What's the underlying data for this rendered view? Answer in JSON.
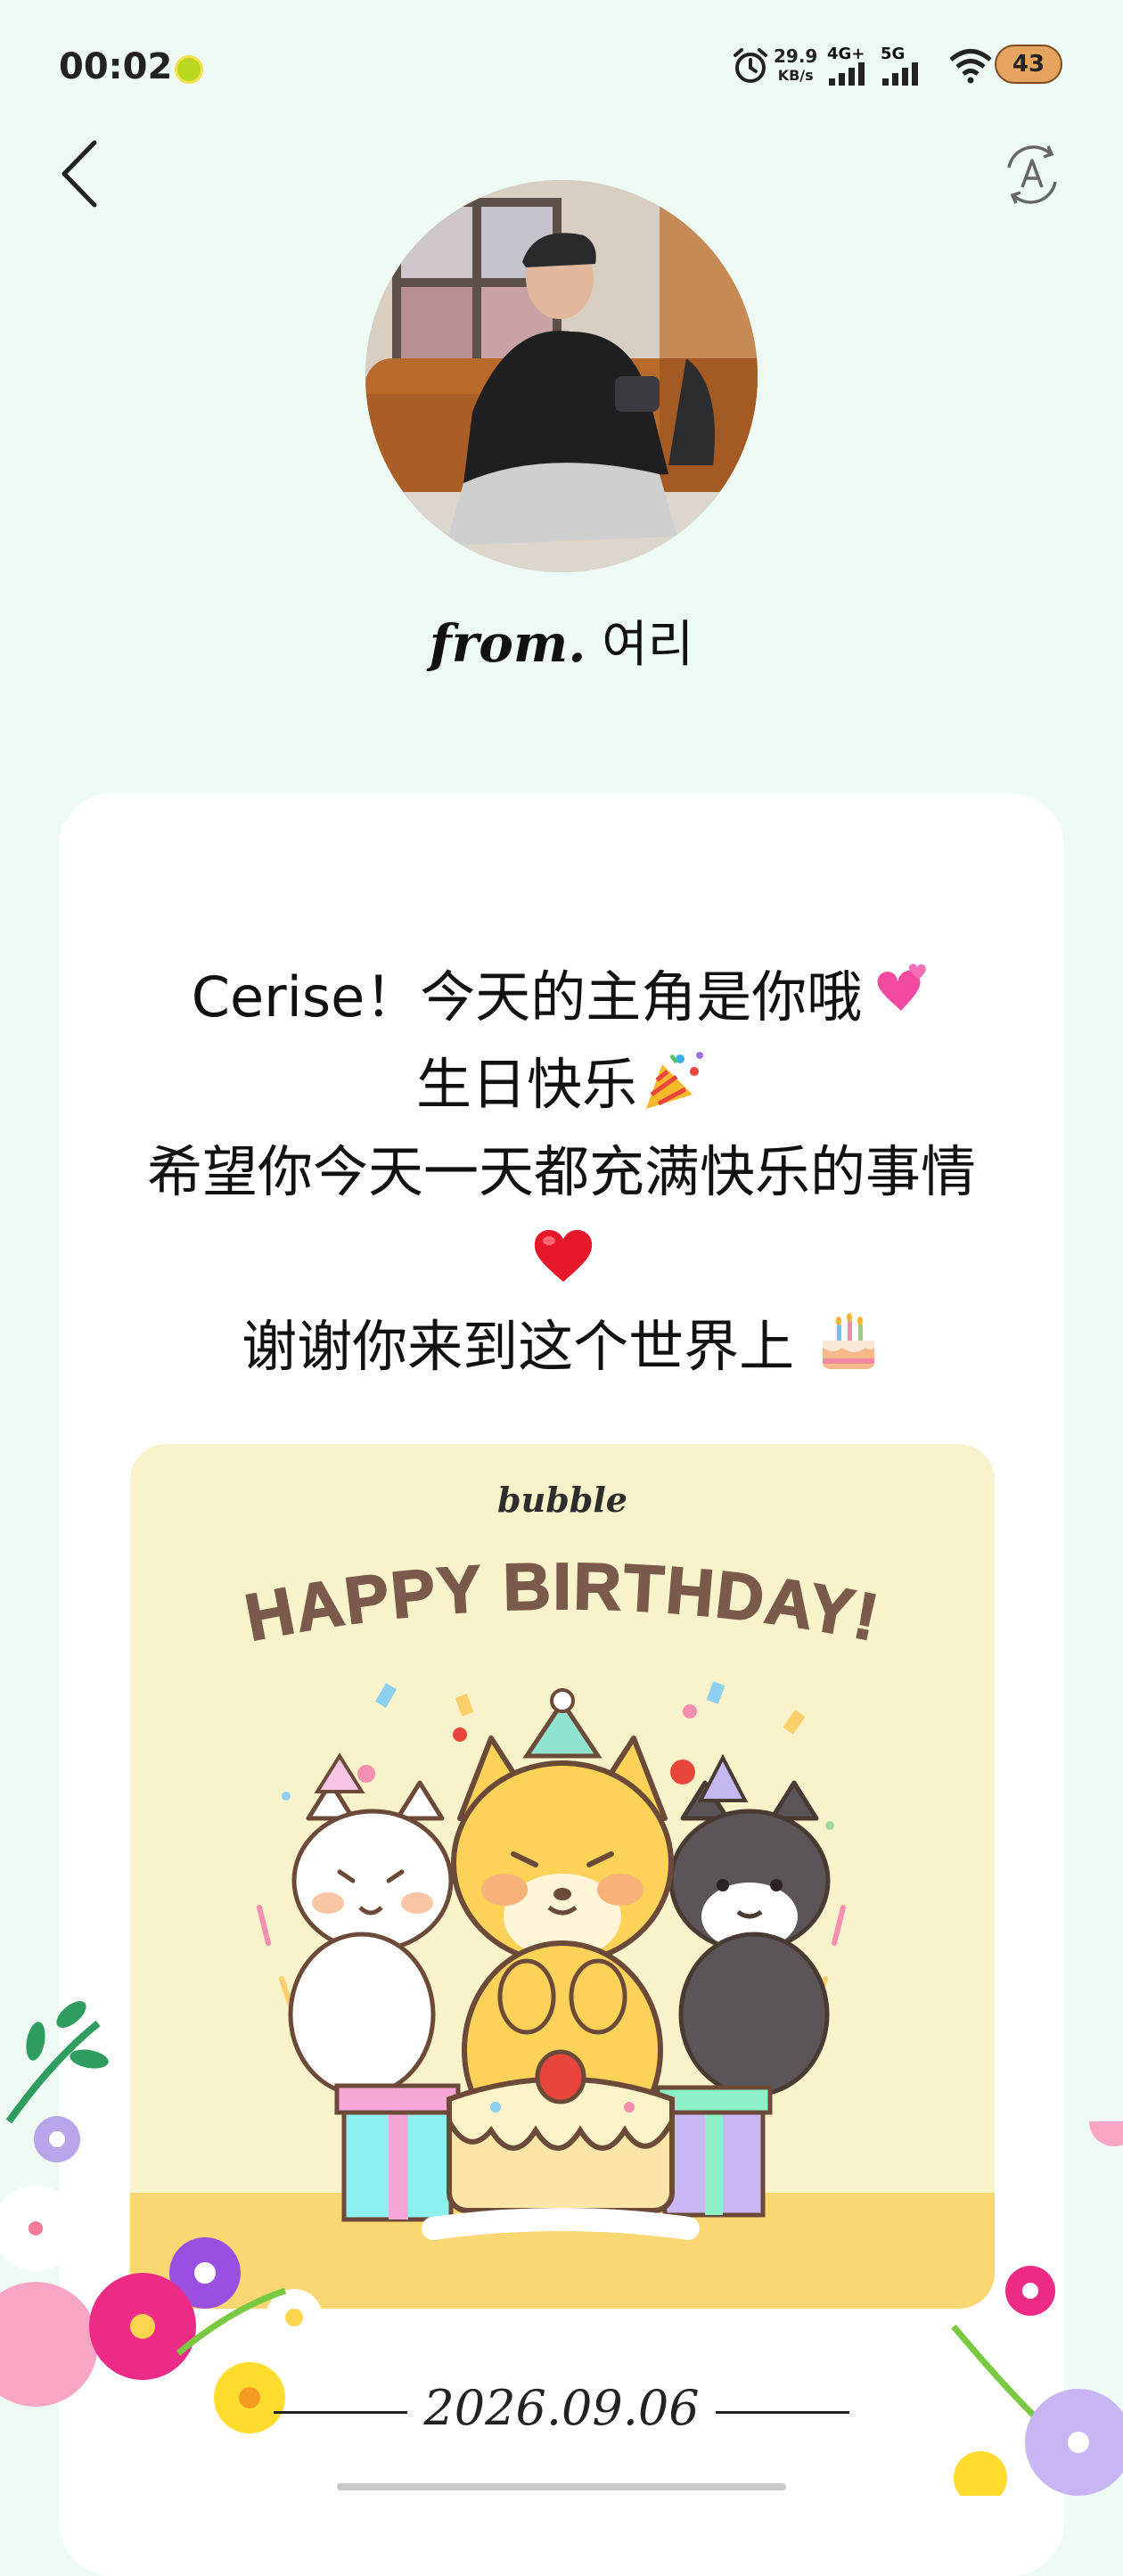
{
  "status_bar": {
    "time": "00:02",
    "net_speed_value": "29.9",
    "net_speed_unit": "KB/s",
    "network_a": "4G+",
    "network_b": "5G",
    "battery": "43"
  },
  "header": {
    "back_icon": "chevron-left-icon",
    "translate_icon": "translate-icon",
    "from_label": "from.",
    "sender_name": "여리"
  },
  "message": {
    "lines": [
      "Cerise！今天的主角是你哦",
      "生日快乐",
      "希望你今天一天都充满快乐的事情",
      "",
      "谢谢你来到这个世界上 "
    ]
  },
  "birthday_card": {
    "brand": "bubble",
    "headline": "HAPPY BIRTHDAY!",
    "colors": {
      "background": "#f9f3cb",
      "headline": "#7a5a4a",
      "floor": "#fbd772"
    }
  },
  "footer": {
    "date": "2026.09.06"
  },
  "colors": {
    "page_background": "#eefaf4",
    "card_background": "#ffffff"
  }
}
